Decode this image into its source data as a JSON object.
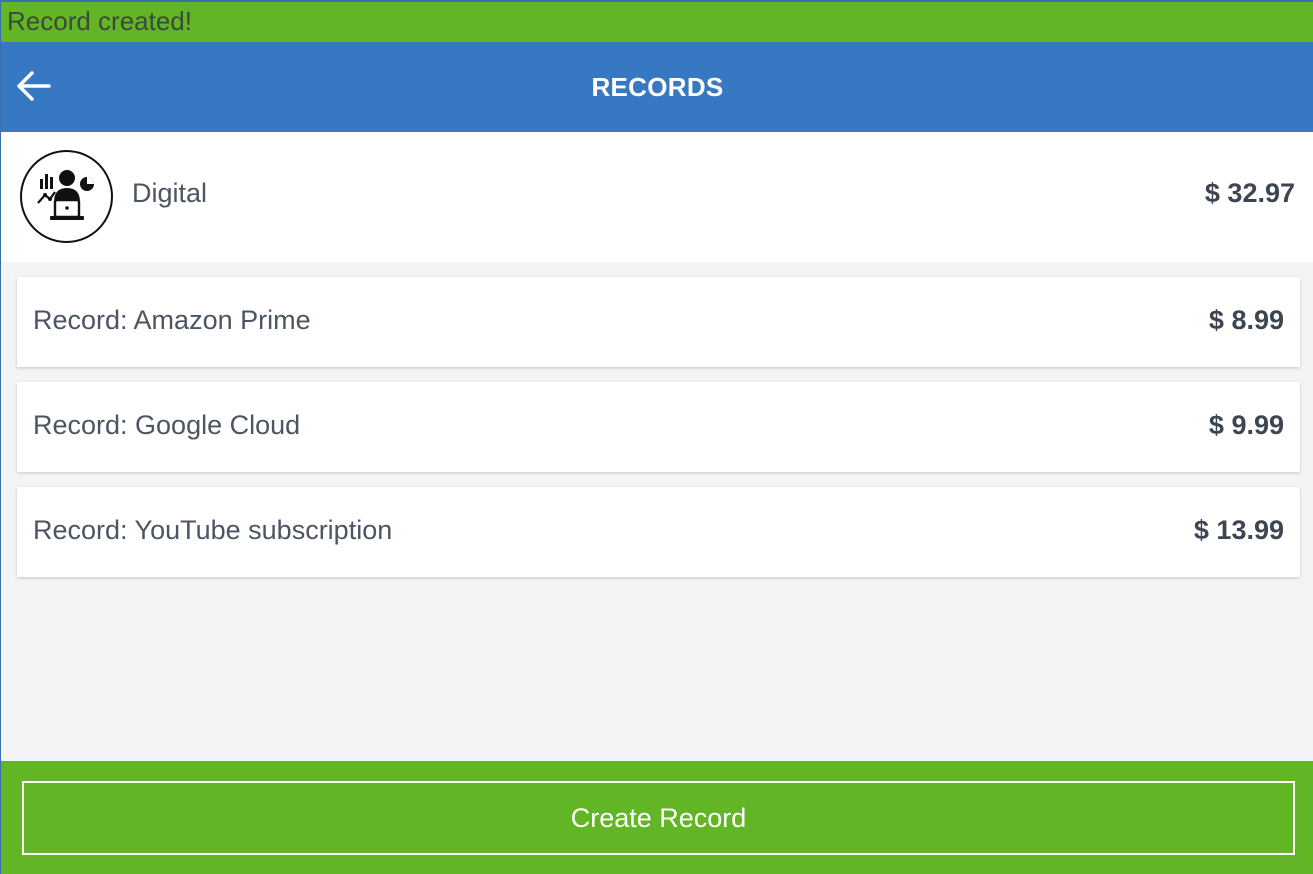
{
  "toast": {
    "message": "Record created!"
  },
  "header": {
    "title": "RECORDS",
    "back_icon": "arrow-left-icon"
  },
  "category": {
    "name": "Digital",
    "total": "$ 32.97",
    "icon": "person-analytics-icon"
  },
  "records": [
    {
      "label": "Record: Amazon Prime",
      "amount": "$ 8.99"
    },
    {
      "label": "Record: Google Cloud",
      "amount": "$ 9.99"
    },
    {
      "label": "Record: YouTube subscription",
      "amount": "$ 13.99"
    }
  ],
  "footer": {
    "create_label": "Create Record"
  },
  "colors": {
    "toast_bg": "#62b524",
    "header_bg": "#3778c2",
    "footer_bg": "#62b524",
    "page_bg": "#f3f4f6"
  }
}
